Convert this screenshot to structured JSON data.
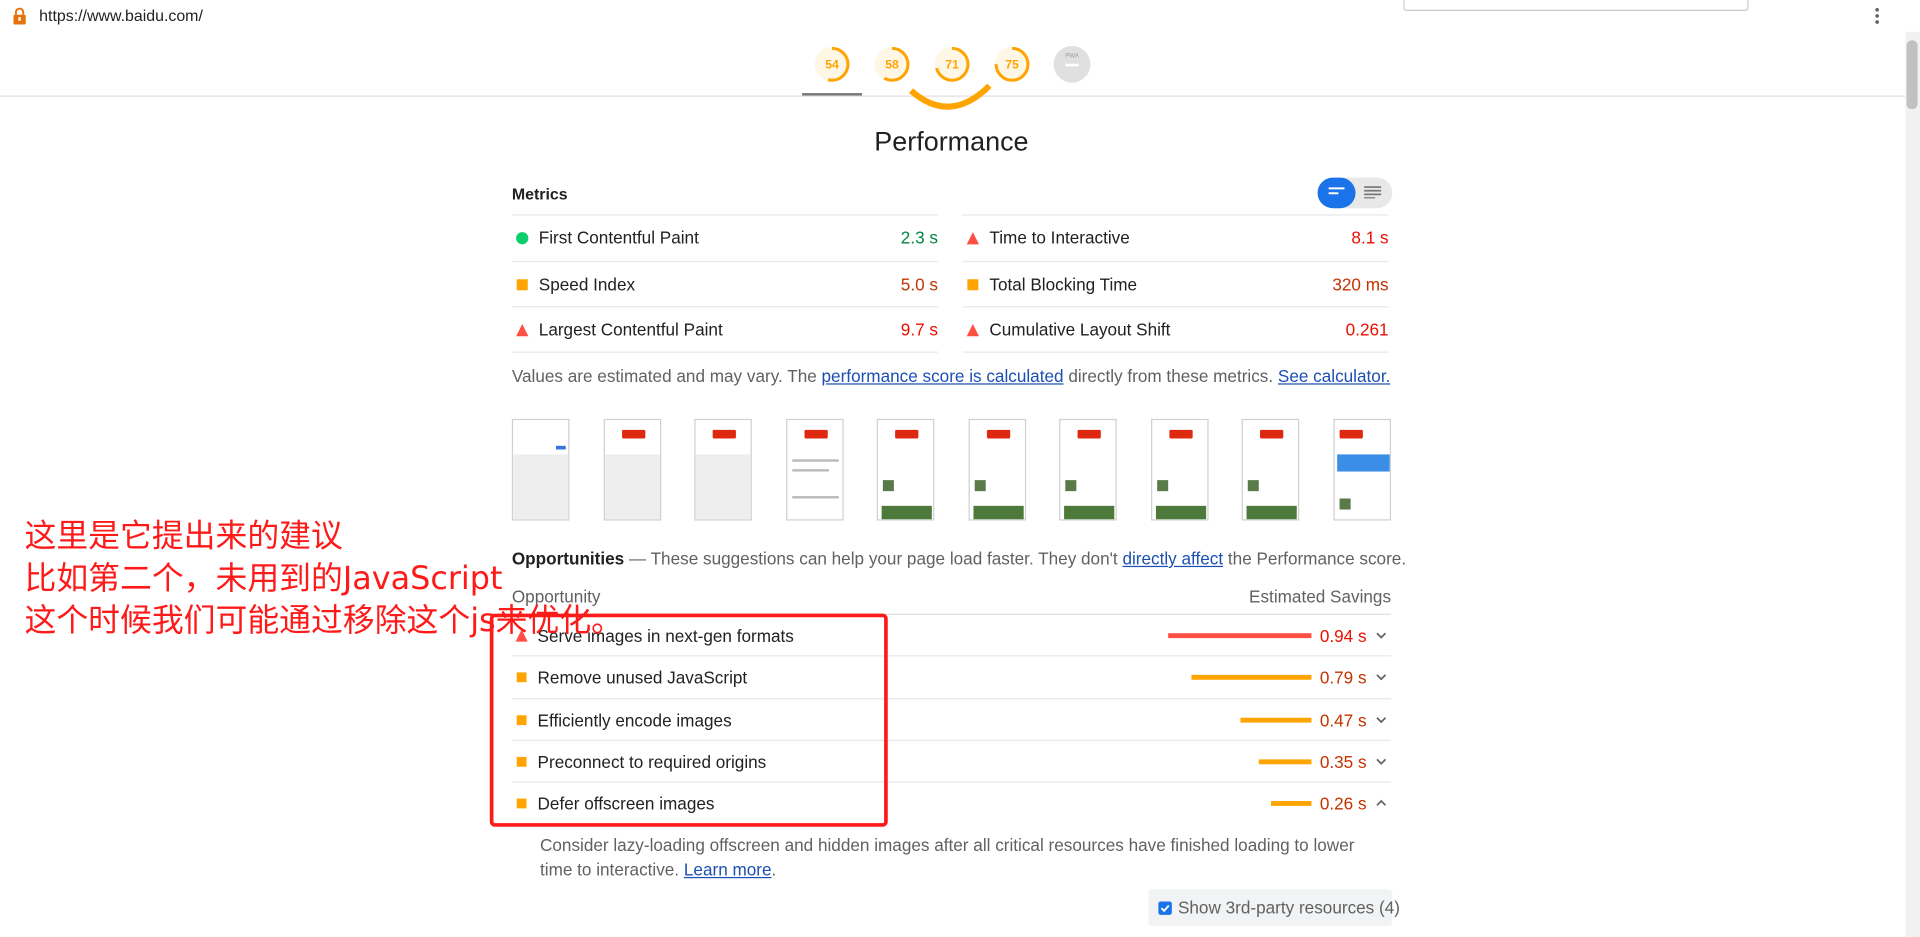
{
  "browser": {
    "url": "https://www.baidu.com/",
    "icons": {
      "site": "lock-icon",
      "menu": "more-vert-icon"
    }
  },
  "gauges": [
    {
      "score": "54",
      "fraction": 0.54,
      "color": "#ffa400"
    },
    {
      "score": "58",
      "fraction": 0.58,
      "color": "#ffa400"
    },
    {
      "score": "71",
      "fraction": 0.71,
      "color": "#ffa400"
    },
    {
      "score": "75",
      "fraction": 0.75,
      "color": "#ffa400"
    },
    {
      "score": "PWA",
      "fraction": 0,
      "color": "#bdbdbd"
    }
  ],
  "performance": {
    "title": "Performance",
    "metrics_heading": "Metrics",
    "metrics_left": [
      {
        "name": "First Contentful Paint",
        "value": "2.3 s",
        "status": "pass"
      },
      {
        "name": "Speed Index",
        "value": "5.0 s",
        "status": "average"
      },
      {
        "name": "Largest Contentful Paint",
        "value": "9.7 s",
        "status": "fail"
      }
    ],
    "metrics_right": [
      {
        "name": "Time to Interactive",
        "value": "8.1 s",
        "status": "fail"
      },
      {
        "name": "Total Blocking Time",
        "value": "320 ms",
        "status": "average"
      },
      {
        "name": "Cumulative Layout Shift",
        "value": "0.261",
        "status": "fail"
      }
    ],
    "note": {
      "prefix": "Values are estimated and may vary. The ",
      "link1": "performance score is calculated",
      "middle": " directly from these metrics. ",
      "link2": "See calculator."
    }
  },
  "opportunities": {
    "heading": "Opportunities",
    "heading_rest": " — These suggestions can help your page load faster. They don't ",
    "heading_link": "directly affect",
    "heading_end": " the Performance score.",
    "col_opportunity": "Opportunity",
    "col_savings": "Estimated Savings",
    "items": [
      {
        "name": "Serve images in next-gen formats",
        "savings": "0.94 s",
        "fraction": 1.0,
        "status": "fail",
        "expanded": false
      },
      {
        "name": "Remove unused JavaScript",
        "savings": "0.79 s",
        "fraction": 0.84,
        "status": "average",
        "expanded": false
      },
      {
        "name": "Efficiently encode images",
        "savings": "0.47 s",
        "fraction": 0.5,
        "status": "average",
        "expanded": false
      },
      {
        "name": "Preconnect to required origins",
        "savings": "0.35 s",
        "fraction": 0.37,
        "status": "average",
        "expanded": false
      },
      {
        "name": "Defer offscreen images",
        "savings": "0.26 s",
        "fraction": 0.28,
        "status": "average",
        "expanded": true
      }
    ],
    "description": "Consider lazy-loading offscreen and hidden images after all critical resources have finished loading to lower time to interactive. ",
    "learn_more": "Learn more",
    "third_party_label": "Show 3rd-party resources (4)",
    "third_party_checked": true
  },
  "annotation": {
    "line1": "这里是它提出来的建议",
    "line2": "比如第二个，未用到的JavaScript",
    "line3": "这个时候我们可能通过移除这个js来优化。"
  },
  "colors": {
    "pass": "#0cce6b",
    "pass_text": "#018642",
    "average": "#ffa400",
    "average_text": "#c33300",
    "fail": "#ff4e42",
    "fail_text": "#eb0f00",
    "annotation": "#ff1a1a",
    "link": "#1b4fb4"
  }
}
